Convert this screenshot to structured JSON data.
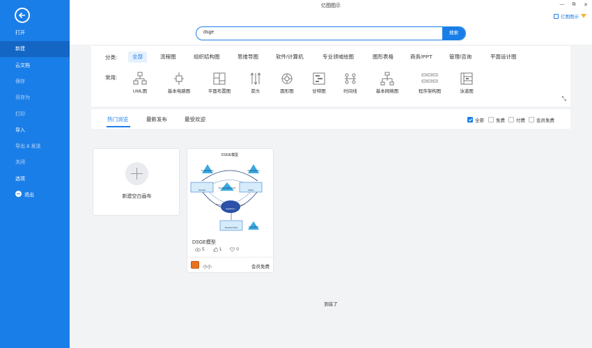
{
  "app": {
    "title": "亿图图示",
    "brand": "亿图图示"
  },
  "sidebar": {
    "items": [
      {
        "label": "打开",
        "state": "normal"
      },
      {
        "label": "新建",
        "state": "active"
      },
      {
        "label": "云文档",
        "state": "normal"
      },
      {
        "label": "保存",
        "state": "dim"
      },
      {
        "label": "另存为",
        "state": "dim"
      },
      {
        "label": "打印",
        "state": "dim"
      },
      {
        "label": "导入",
        "state": "normal"
      },
      {
        "label": "导出 & 发送",
        "state": "dim"
      },
      {
        "label": "关闭",
        "state": "dim"
      },
      {
        "label": "选项",
        "state": "normal"
      },
      {
        "label": "退出",
        "state": "normal"
      }
    ]
  },
  "search": {
    "value": "dsge",
    "button": "搜索"
  },
  "categories": {
    "label": "分类:",
    "items": [
      "全部",
      "流程图",
      "组织结构图",
      "思维导图",
      "软件/计算机",
      "专业领域绘图",
      "图形表格",
      "商务/PPT",
      "管理/咨询",
      "平面设计图"
    ],
    "active": "全部"
  },
  "common": {
    "label": "常用:",
    "items": [
      "UML图",
      "基本电路图",
      "平面布置图",
      "箭头",
      "圆形图",
      "甘特图",
      "时间线",
      "基本网络图",
      "程序架构图",
      "泳道图"
    ]
  },
  "tabs": {
    "items": [
      "热门浏览",
      "最新发布",
      "最受欢迎"
    ],
    "active": "热门浏览"
  },
  "filters": [
    {
      "label": "全部",
      "checked": true
    },
    {
      "label": "免费",
      "checked": false
    },
    {
      "label": "付费",
      "checked": false
    },
    {
      "label": "会员免费",
      "checked": false
    }
  ],
  "blank_card": {
    "label": "新建空白画布"
  },
  "template": {
    "title": "DSGE模型",
    "thumb_title": "DSGE模型",
    "views": "5",
    "likes": "1",
    "favorites": "0",
    "author": "小小",
    "badge": "会员免费",
    "diagram_labels": {
      "demand_shock": "Demand shocks",
      "markup_shock": "Mark-up shocks",
      "monetary_shock": "Monetary policy shocks",
      "policy_shock": "Policy shocks",
      "demand": "Demand",
      "supply": "Supply",
      "equilibrium": "Equilibrium",
      "monetary": "Monetary Policy"
    }
  },
  "footer": {
    "end_text": "到底了"
  },
  "colors": {
    "accent": "#1a7ee8",
    "sidebar": "#1a7ee8",
    "sidebar_active": "#1466c4"
  }
}
